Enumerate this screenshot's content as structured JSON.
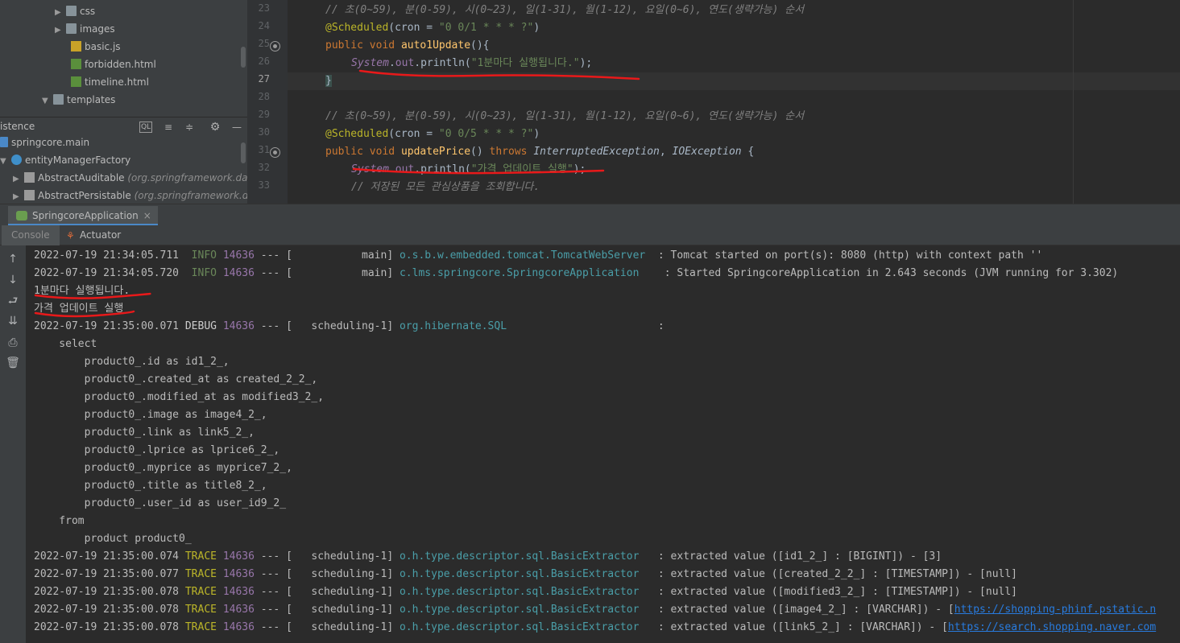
{
  "project_tree": {
    "items": [
      {
        "label": "css",
        "kind": "folder",
        "arrow": "▶"
      },
      {
        "label": "images",
        "kind": "folder",
        "arrow": "▶"
      },
      {
        "label": "basic.js",
        "kind": "js",
        "arrow": ""
      },
      {
        "label": "forbidden.html",
        "kind": "html",
        "arrow": ""
      },
      {
        "label": "timeline.html",
        "kind": "html",
        "arrow": ""
      },
      {
        "label": "templates",
        "kind": "folder",
        "arrow": "▼"
      }
    ]
  },
  "persistence": {
    "title": "istence",
    "tools": [
      "QL",
      "≡",
      "≑",
      "⚙",
      "—"
    ],
    "items": [
      {
        "label": "springcore.main",
        "hint": ""
      },
      {
        "label": "entityManagerFactory",
        "hint": ""
      },
      {
        "label": "AbstractAuditable",
        "hint": "(org.springframework.data.jpa"
      },
      {
        "label": "AbstractPersistable",
        "hint": "(org.springframework.data.jpa"
      }
    ]
  },
  "editor": {
    "line_numbers": [
      "23",
      "24",
      "25",
      "26",
      "27",
      "28",
      "29",
      "30",
      "31",
      "32",
      "33"
    ],
    "current_line": "27",
    "comment1": "// 초(0~59), 분(0-59), 시(0~23), 일(1-31), 월(1-12), 요일(0~6), 연도(생략가능) 순서",
    "scheduled": "@Scheduled",
    "cron_attr": "cron = ",
    "cron1": "\"0 0/1 * * * ?\"",
    "kw_public": "public",
    "kw_void": "void",
    "method1": "auto1Update",
    "system": "System",
    "out": "out",
    "println": "println",
    "msg1": "\"1분마다 실행됩니다.\"",
    "close_brace": "}",
    "comment2": "// 초(0~59), 분(0-59), 시(0~23), 일(1-31), 월(1-12), 요일(0~6), 연도(생략가능) 순서",
    "cron2": "\"0 0/5 * * * ?\"",
    "method2": "updatePrice",
    "kw_throws": "throws",
    "ex1": "InterruptedException",
    "ex2": "IOException",
    "msg2": "\"가격 업데이트 실행\"",
    "comment3": "// 저장된 모든 관심상품을 조회합니다."
  },
  "run_panel": {
    "tab_label": "SpringcoreApplication",
    "close": "×",
    "console_tab": "Console",
    "actuator_tab": "Actuator"
  },
  "console": {
    "lines": [
      {
        "type": "log",
        "ts": "2022-07-19 21:34:05.711",
        "level": " INFO",
        "level_class": "lv-info",
        "pid": "14636",
        "sep": " --- [",
        "thread": "           main]",
        "logger": "o.s.b.w.embedded.tomcat.TomcatWebServer ",
        "msg": " : Tomcat started on port(s): 8080 (http) with context path ''"
      },
      {
        "type": "log",
        "ts": "2022-07-19 21:34:05.720",
        "level": " INFO",
        "level_class": "lv-info",
        "pid": "14636",
        "sep": " --- [",
        "thread": "           main]",
        "logger": "c.lms.springcore.SpringcoreApplication   ",
        "msg": " : Started SpringcoreApplication in 2.643 seconds (JVM running for 3.302)"
      },
      {
        "type": "plain",
        "text": "1분마다 실행됩니다."
      },
      {
        "type": "plain",
        "text": "가격 업데이트 실행"
      },
      {
        "type": "log",
        "ts": "2022-07-19 21:35:00.071",
        "level": "DEBUG",
        "level_class": "lv-debug",
        "pid": "14636",
        "sep": " --- [",
        "thread": "   scheduling-1]",
        "logger": "org.hibernate.SQL                       ",
        "msg": " :"
      },
      {
        "type": "plain",
        "text": "    select"
      },
      {
        "type": "plain",
        "text": "        product0_.id as id1_2_,"
      },
      {
        "type": "plain",
        "text": "        product0_.created_at as created_2_2_,"
      },
      {
        "type": "plain",
        "text": "        product0_.modified_at as modified3_2_,"
      },
      {
        "type": "plain",
        "text": "        product0_.image as image4_2_,"
      },
      {
        "type": "plain",
        "text": "        product0_.link as link5_2_,"
      },
      {
        "type": "plain",
        "text": "        product0_.lprice as lprice6_2_,"
      },
      {
        "type": "plain",
        "text": "        product0_.myprice as myprice7_2_,"
      },
      {
        "type": "plain",
        "text": "        product0_.title as title8_2_,"
      },
      {
        "type": "plain",
        "text": "        product0_.user_id as user_id9_2_"
      },
      {
        "type": "plain",
        "text": "    from"
      },
      {
        "type": "plain",
        "text": "        product product0_"
      },
      {
        "type": "log",
        "ts": "2022-07-19 21:35:00.074",
        "level": "TRACE",
        "level_class": "lv-trace",
        "pid": "14636",
        "sep": " --- [",
        "thread": "   scheduling-1]",
        "logger": "o.h.type.descriptor.sql.BasicExtractor  ",
        "msg": " : extracted value ([id1_2_] : [BIGINT]) - [3]"
      },
      {
        "type": "log",
        "ts": "2022-07-19 21:35:00.077",
        "level": "TRACE",
        "level_class": "lv-trace",
        "pid": "14636",
        "sep": " --- [",
        "thread": "   scheduling-1]",
        "logger": "o.h.type.descriptor.sql.BasicExtractor  ",
        "msg": " : extracted value ([created_2_2_] : [TIMESTAMP]) - [null]"
      },
      {
        "type": "log",
        "ts": "2022-07-19 21:35:00.078",
        "level": "TRACE",
        "level_class": "lv-trace",
        "pid": "14636",
        "sep": " --- [",
        "thread": "   scheduling-1]",
        "logger": "o.h.type.descriptor.sql.BasicExtractor  ",
        "msg": " : extracted value ([modified3_2_] : [TIMESTAMP]) - [null]"
      },
      {
        "type": "log",
        "ts": "2022-07-19 21:35:00.078",
        "level": "TRACE",
        "level_class": "lv-trace",
        "pid": "14636",
        "sep": " --- [",
        "thread": "   scheduling-1]",
        "logger": "o.h.type.descriptor.sql.BasicExtractor  ",
        "msg": " : extracted value ([image4_2_] : [VARCHAR]) - [",
        "link": "https://shopping-phinf.pstatic.n"
      },
      {
        "type": "log",
        "ts": "2022-07-19 21:35:00.078",
        "level": "TRACE",
        "level_class": "lv-trace",
        "pid": "14636",
        "sep": " --- [",
        "thread": "   scheduling-1]",
        "logger": "o.h.type.descriptor.sql.BasicExtractor  ",
        "msg": " : extracted value ([link5_2_] : [VARCHAR]) - [",
        "link": "https://search.shopping.naver.com"
      }
    ]
  },
  "colors": {
    "annotation_red": "#e8191a",
    "editor_bg": "#2b2b2b",
    "panel_bg": "#3c3f41"
  }
}
